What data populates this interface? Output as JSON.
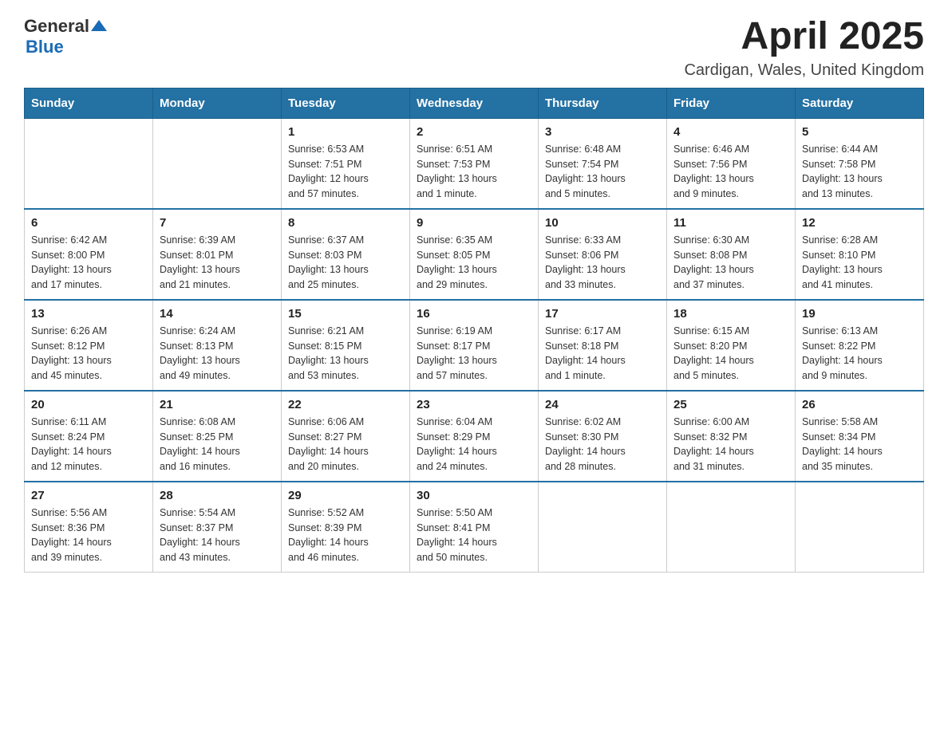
{
  "logo": {
    "text_general": "General",
    "text_blue": "Blue"
  },
  "header": {
    "title": "April 2025",
    "subtitle": "Cardigan, Wales, United Kingdom"
  },
  "weekdays": [
    "Sunday",
    "Monday",
    "Tuesday",
    "Wednesday",
    "Thursday",
    "Friday",
    "Saturday"
  ],
  "weeks": [
    [
      {
        "day": "",
        "info": ""
      },
      {
        "day": "",
        "info": ""
      },
      {
        "day": "1",
        "info": "Sunrise: 6:53 AM\nSunset: 7:51 PM\nDaylight: 12 hours\nand 57 minutes."
      },
      {
        "day": "2",
        "info": "Sunrise: 6:51 AM\nSunset: 7:53 PM\nDaylight: 13 hours\nand 1 minute."
      },
      {
        "day": "3",
        "info": "Sunrise: 6:48 AM\nSunset: 7:54 PM\nDaylight: 13 hours\nand 5 minutes."
      },
      {
        "day": "4",
        "info": "Sunrise: 6:46 AM\nSunset: 7:56 PM\nDaylight: 13 hours\nand 9 minutes."
      },
      {
        "day": "5",
        "info": "Sunrise: 6:44 AM\nSunset: 7:58 PM\nDaylight: 13 hours\nand 13 minutes."
      }
    ],
    [
      {
        "day": "6",
        "info": "Sunrise: 6:42 AM\nSunset: 8:00 PM\nDaylight: 13 hours\nand 17 minutes."
      },
      {
        "day": "7",
        "info": "Sunrise: 6:39 AM\nSunset: 8:01 PM\nDaylight: 13 hours\nand 21 minutes."
      },
      {
        "day": "8",
        "info": "Sunrise: 6:37 AM\nSunset: 8:03 PM\nDaylight: 13 hours\nand 25 minutes."
      },
      {
        "day": "9",
        "info": "Sunrise: 6:35 AM\nSunset: 8:05 PM\nDaylight: 13 hours\nand 29 minutes."
      },
      {
        "day": "10",
        "info": "Sunrise: 6:33 AM\nSunset: 8:06 PM\nDaylight: 13 hours\nand 33 minutes."
      },
      {
        "day": "11",
        "info": "Sunrise: 6:30 AM\nSunset: 8:08 PM\nDaylight: 13 hours\nand 37 minutes."
      },
      {
        "day": "12",
        "info": "Sunrise: 6:28 AM\nSunset: 8:10 PM\nDaylight: 13 hours\nand 41 minutes."
      }
    ],
    [
      {
        "day": "13",
        "info": "Sunrise: 6:26 AM\nSunset: 8:12 PM\nDaylight: 13 hours\nand 45 minutes."
      },
      {
        "day": "14",
        "info": "Sunrise: 6:24 AM\nSunset: 8:13 PM\nDaylight: 13 hours\nand 49 minutes."
      },
      {
        "day": "15",
        "info": "Sunrise: 6:21 AM\nSunset: 8:15 PM\nDaylight: 13 hours\nand 53 minutes."
      },
      {
        "day": "16",
        "info": "Sunrise: 6:19 AM\nSunset: 8:17 PM\nDaylight: 13 hours\nand 57 minutes."
      },
      {
        "day": "17",
        "info": "Sunrise: 6:17 AM\nSunset: 8:18 PM\nDaylight: 14 hours\nand 1 minute."
      },
      {
        "day": "18",
        "info": "Sunrise: 6:15 AM\nSunset: 8:20 PM\nDaylight: 14 hours\nand 5 minutes."
      },
      {
        "day": "19",
        "info": "Sunrise: 6:13 AM\nSunset: 8:22 PM\nDaylight: 14 hours\nand 9 minutes."
      }
    ],
    [
      {
        "day": "20",
        "info": "Sunrise: 6:11 AM\nSunset: 8:24 PM\nDaylight: 14 hours\nand 12 minutes."
      },
      {
        "day": "21",
        "info": "Sunrise: 6:08 AM\nSunset: 8:25 PM\nDaylight: 14 hours\nand 16 minutes."
      },
      {
        "day": "22",
        "info": "Sunrise: 6:06 AM\nSunset: 8:27 PM\nDaylight: 14 hours\nand 20 minutes."
      },
      {
        "day": "23",
        "info": "Sunrise: 6:04 AM\nSunset: 8:29 PM\nDaylight: 14 hours\nand 24 minutes."
      },
      {
        "day": "24",
        "info": "Sunrise: 6:02 AM\nSunset: 8:30 PM\nDaylight: 14 hours\nand 28 minutes."
      },
      {
        "day": "25",
        "info": "Sunrise: 6:00 AM\nSunset: 8:32 PM\nDaylight: 14 hours\nand 31 minutes."
      },
      {
        "day": "26",
        "info": "Sunrise: 5:58 AM\nSunset: 8:34 PM\nDaylight: 14 hours\nand 35 minutes."
      }
    ],
    [
      {
        "day": "27",
        "info": "Sunrise: 5:56 AM\nSunset: 8:36 PM\nDaylight: 14 hours\nand 39 minutes."
      },
      {
        "day": "28",
        "info": "Sunrise: 5:54 AM\nSunset: 8:37 PM\nDaylight: 14 hours\nand 43 minutes."
      },
      {
        "day": "29",
        "info": "Sunrise: 5:52 AM\nSunset: 8:39 PM\nDaylight: 14 hours\nand 46 minutes."
      },
      {
        "day": "30",
        "info": "Sunrise: 5:50 AM\nSunset: 8:41 PM\nDaylight: 14 hours\nand 50 minutes."
      },
      {
        "day": "",
        "info": ""
      },
      {
        "day": "",
        "info": ""
      },
      {
        "day": "",
        "info": ""
      }
    ]
  ]
}
